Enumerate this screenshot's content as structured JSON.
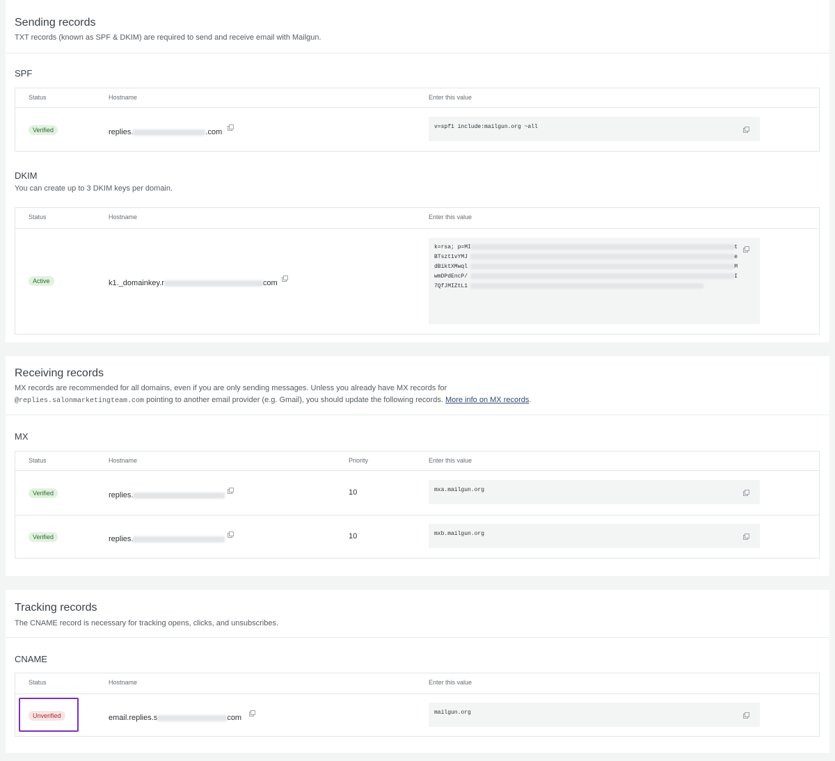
{
  "sending": {
    "title": "Sending records",
    "description": "TXT records (known as SPF & DKIM) are required to send and receive email with Mailgun.",
    "spf": {
      "title": "SPF",
      "headers": {
        "status": "Status",
        "hostname": "Hostname",
        "value": "Enter this value"
      },
      "row": {
        "status": "Verified",
        "host_prefix": "replies.",
        "host_suffix": ".com",
        "value": "v=spf1 include:mailgun.org ~all"
      }
    },
    "dkim": {
      "title": "DKIM",
      "description": "You can create up to 3 DKIM keys per domain.",
      "headers": {
        "status": "Status",
        "hostname": "Hostname",
        "value": "Enter this value"
      },
      "row": {
        "status": "Active",
        "host_prefix": "k1._domainkey.r",
        "host_suffix": "com",
        "value_lines": [
          "k=rsa; p=MI",
          "BTszt1vYMJ",
          "dBiktXMwql",
          "wmDPdEncP/",
          "7QfJMIZtL1"
        ],
        "value_line_ends": [
          "t",
          "e",
          "M",
          "I",
          ""
        ]
      }
    }
  },
  "receiving": {
    "title": "Receiving records",
    "description_line1": "MX records are recommended for all domains, even if you are only sending messages. Unless you already have MX records for",
    "description_mono": "@replies.salonmarketingteam.com",
    "description_line2": " pointing to another email provider (e.g. Gmail), you should update the following records. ",
    "description_link": "More info on MX records",
    "description_end": ".",
    "mx": {
      "title": "MX",
      "headers": {
        "status": "Status",
        "hostname": "Hostname",
        "priority": "Priority",
        "value": "Enter this value"
      },
      "rows": [
        {
          "status": "Verified",
          "host_prefix": "replies.",
          "priority": "10",
          "value": "mxa.mailgun.org"
        },
        {
          "status": "Verified",
          "host_prefix": "replies.",
          "priority": "10",
          "value": "mxb.mailgun.org"
        }
      ]
    }
  },
  "tracking": {
    "title": "Tracking records",
    "description": "The CNAME record is necessary for tracking opens, clicks, and unsubscribes.",
    "cname": {
      "title": "CNAME",
      "headers": {
        "status": "Status",
        "hostname": "Hostname",
        "value": "Enter this value"
      },
      "row": {
        "status": "Unverified",
        "host_prefix": "email.replies.s",
        "host_suffix": "com",
        "value": "mailgun.org"
      }
    }
  },
  "icons": {
    "copy": "copy-icon"
  },
  "colors": {
    "verified_bg": "#e2f1e0",
    "verified_text": "#2c6b2c",
    "unverified_bg": "#fbe3e3",
    "unverified_text": "#9a2f2f",
    "highlight": "#7b2fbe",
    "link": "#2a4a78"
  }
}
